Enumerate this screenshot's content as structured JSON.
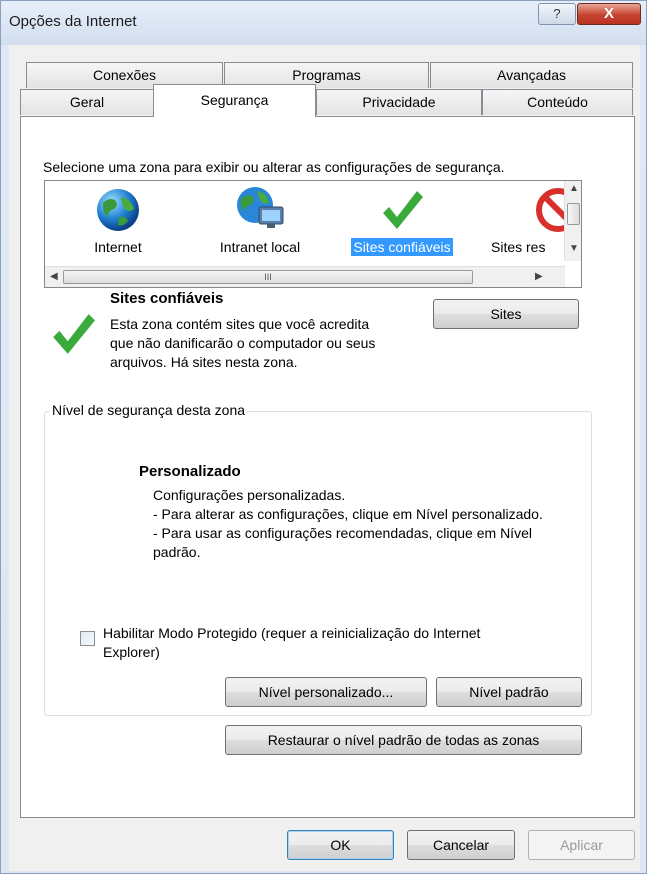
{
  "window": {
    "title": "Opções da Internet",
    "help": "?",
    "close": "X"
  },
  "tabs_top": [
    "Conexões",
    "Programas",
    "Avançadas"
  ],
  "tabs_bottom": [
    "Geral",
    "Segurança",
    "Privacidade",
    "Conteúdo"
  ],
  "zone_instruction": "Selecione uma zona para exibir ou alterar as configurações de segurança.",
  "zones": [
    {
      "label": "Internet",
      "icon": "globe-icon"
    },
    {
      "label": "Intranet local",
      "icon": "intranet-icon"
    },
    {
      "label": "Sites confiáveis",
      "icon": "checkmark-icon",
      "selected": true
    },
    {
      "label": "Sites res",
      "icon": "restricted-icon"
    }
  ],
  "scroll_thumb_text": "III",
  "zone_info": {
    "title": "Sites confiáveis",
    "description": "Esta zona contém sites que você acredita que não danificarão o computador ou seus arquivos. Há sites nesta zona."
  },
  "sites_button": "Sites",
  "security_level": {
    "legend": "Nível de segurança desta zona",
    "title": "Personalizado",
    "lines": [
      "Configurações personalizadas.",
      "- Para alterar as configurações, clique em Nível personalizado.",
      "- Para usar as configurações recomendadas, clique em Nível padrão."
    ],
    "protected_mode_label": "Habilitar Modo Protegido (requer a reinicialização do Internet Explorer)",
    "protected_mode_checked": false,
    "custom_level_button": "Nível personalizado...",
    "default_level_button": "Nível padrão"
  },
  "restore_button": "Restaurar o nível padrão de todas as zonas",
  "footer": {
    "ok": "OK",
    "cancel": "Cancelar",
    "apply": "Aplicar"
  },
  "colors": {
    "selection": "#3399ff",
    "check_green": "#3aaa3a",
    "close_red": "#c5452f"
  }
}
